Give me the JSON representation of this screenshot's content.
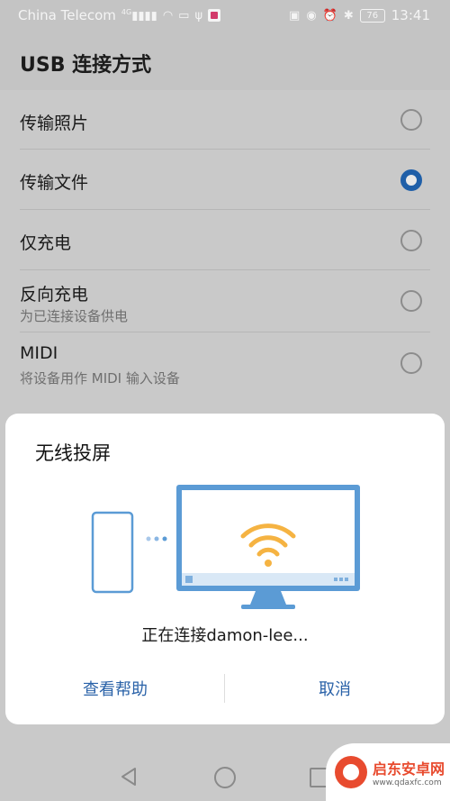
{
  "status_bar": {
    "carrier": "China Telecom",
    "signal": "4G",
    "battery": "76",
    "time": "13:41"
  },
  "header": {
    "title": "USB 连接方式"
  },
  "options": [
    {
      "label": "传输照片",
      "subtitle": "",
      "selected": false
    },
    {
      "label": "传输文件",
      "subtitle": "",
      "selected": true
    },
    {
      "label": "仅充电",
      "subtitle": "",
      "selected": false
    },
    {
      "label": "反向充电",
      "subtitle": "为已连接设备供电",
      "selected": false
    },
    {
      "label": "MIDI",
      "subtitle": "将设备用作 MIDI 输入设备",
      "selected": false
    }
  ],
  "dialog": {
    "title": "无线投屏",
    "status": "正在连接damon-lee...",
    "help_label": "查看帮助",
    "cancel_label": "取消"
  },
  "watermark": {
    "name": "启东安卓网",
    "url": "www.qdaxfc.com"
  },
  "colors": {
    "accent": "#1f5fa8",
    "dialog_button": "#2a62a8",
    "illustration_blue": "#5b9bd5",
    "wifi": "#f5b342"
  }
}
